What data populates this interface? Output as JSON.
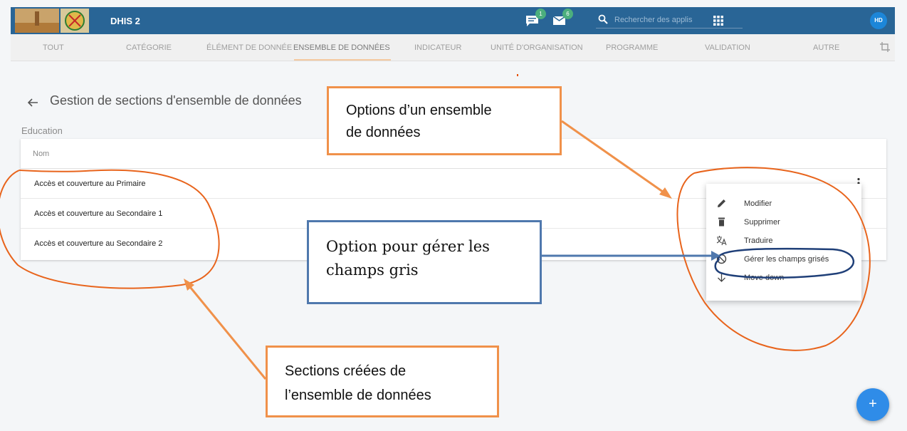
{
  "header": {
    "app_title": "DHIS 2",
    "messages_badge": "1",
    "interpretations_badge": "6",
    "search_placeholder": "Rechercher des applis",
    "avatar_initials": "HD",
    "header_color": "#296596"
  },
  "tabs": [
    {
      "label": "TOUT"
    },
    {
      "label": "CATÉGORIE"
    },
    {
      "label": "ÉLÉMENT DE DONNÉE"
    },
    {
      "label": "ENSEMBLE DE DONNÉES",
      "active": true
    },
    {
      "label": "INDICATEUR"
    },
    {
      "label": "UNITÉ D'ORGANISATION"
    },
    {
      "label": "PROGRAMME"
    },
    {
      "label": "VALIDATION"
    },
    {
      "label": "AUTRE"
    }
  ],
  "page": {
    "title": "Gestion de sections d'ensemble de données",
    "dataset_name": "Education"
  },
  "table": {
    "header": "Nom",
    "rows": [
      {
        "name": "Accès et couverture au Primaire"
      },
      {
        "name": "Accès et couverture au Secondaire 1"
      },
      {
        "name": "Accès et couverture au Secondaire 2"
      }
    ]
  },
  "context_menu": {
    "items": [
      {
        "label": "Modifier",
        "icon": "pencil-icon"
      },
      {
        "label": "Supprimer",
        "icon": "trash-icon"
      },
      {
        "label": "Traduire",
        "icon": "translate-icon"
      },
      {
        "label": "Gérer les champs grisés",
        "icon": "block-icon"
      },
      {
        "label": "Move down",
        "icon": "arrow-down-icon"
      }
    ]
  },
  "fab_label": "+",
  "annotations": {
    "options_callout": [
      "Options d’un ensemble",
      "de données"
    ],
    "grey_fields_callout": [
      "Option pour gérer les",
      "champs gris"
    ],
    "sections_callout": [
      "Sections créées de",
      "l’ensemble de données"
    ],
    "callout_border_color": "#f0914a",
    "grey_callout_border_color": "#4f78ad",
    "circle_color": "#e8641c"
  }
}
